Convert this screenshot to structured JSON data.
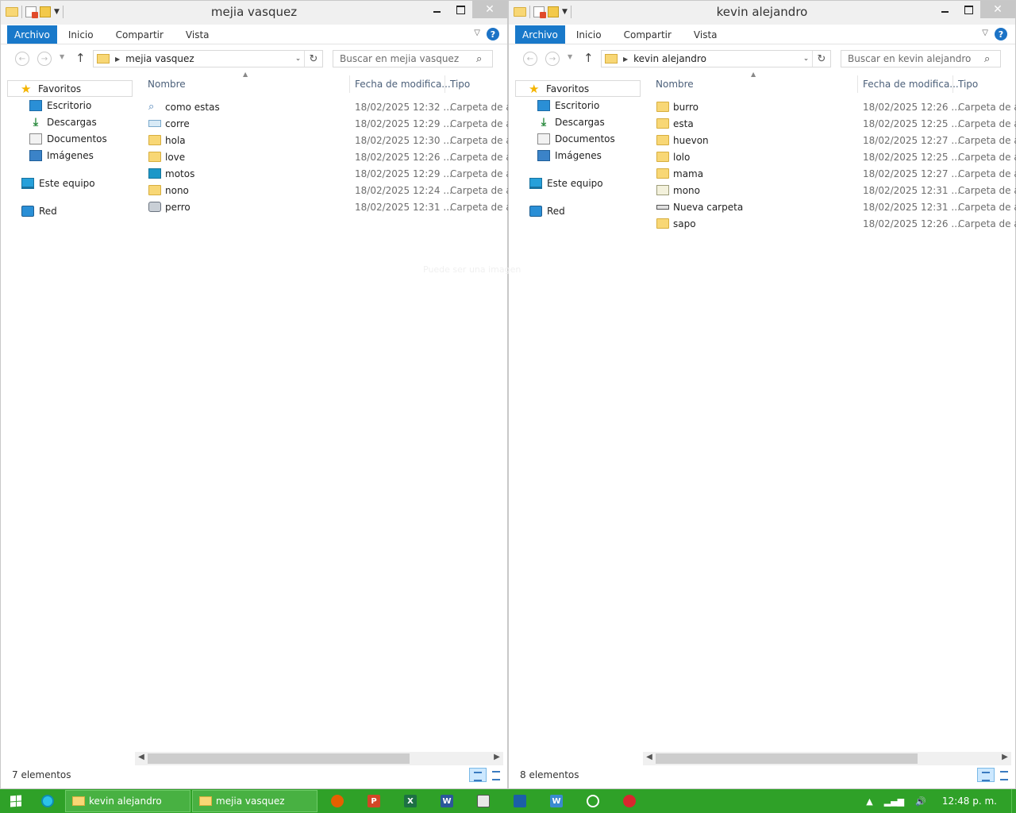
{
  "windows": [
    {
      "title": "mejia vasquez",
      "ribbon": {
        "file": "Archivo",
        "tabs": [
          "Inicio",
          "Compartir",
          "Vista"
        ]
      },
      "address": "mejia vasquez",
      "search_placeholder": "Buscar en mejia vasquez",
      "nav": {
        "favorites": "Favoritos",
        "items": [
          "Escritorio",
          "Descargas",
          "Documentos",
          "Imágenes"
        ],
        "pc": "Este equipo",
        "network": "Red"
      },
      "columns": {
        "name": "Nombre",
        "date": "Fecha de modifica...",
        "type": "Tipo"
      },
      "files": [
        {
          "name": "como estas",
          "date": "18/02/2025 12:32 ...",
          "type": "Carpeta de a",
          "icon": "search-folder-icon"
        },
        {
          "name": "corre",
          "date": "18/02/2025 12:29 ...",
          "type": "Carpeta de a",
          "icon": "drive-folder-icon"
        },
        {
          "name": "hola",
          "date": "18/02/2025 12:30 ...",
          "type": "Carpeta de a",
          "icon": "folder-icon"
        },
        {
          "name": "love",
          "date": "18/02/2025 12:26 ...",
          "type": "Carpeta de a",
          "icon": "folder-icon"
        },
        {
          "name": "motos",
          "date": "18/02/2025 12:29 ...",
          "type": "Carpeta de a",
          "icon": "monitor-folder-icon"
        },
        {
          "name": "nono",
          "date": "18/02/2025 12:24 ...",
          "type": "Carpeta de a",
          "icon": "folder-icon"
        },
        {
          "name": "perro",
          "date": "18/02/2025 12:31 ...",
          "type": "Carpeta de a",
          "icon": "disc-folder-icon"
        }
      ],
      "status": "7 elementos"
    },
    {
      "title": "kevin alejandro",
      "ribbon": {
        "file": "Archivo",
        "tabs": [
          "Inicio",
          "Compartir",
          "Vista"
        ]
      },
      "address": "kevin alejandro",
      "search_placeholder": "Buscar en kevin alejandro",
      "nav": {
        "favorites": "Favoritos",
        "items": [
          "Escritorio",
          "Descargas",
          "Documentos",
          "Imágenes"
        ],
        "pc": "Este equipo",
        "network": "Red"
      },
      "columns": {
        "name": "Nombre",
        "date": "Fecha de modifica...",
        "type": "Tipo"
      },
      "files": [
        {
          "name": "burro",
          "date": "18/02/2025 12:26 ...",
          "type": "Carpeta de a",
          "icon": "folder-icon"
        },
        {
          "name": "esta",
          "date": "18/02/2025 12:25 ...",
          "type": "Carpeta de a",
          "icon": "folder-icon"
        },
        {
          "name": "huevon",
          "date": "18/02/2025 12:27 ...",
          "type": "Carpeta de a",
          "icon": "folder-icon"
        },
        {
          "name": "lolo",
          "date": "18/02/2025 12:25 ...",
          "type": "Carpeta de a",
          "icon": "folder-icon"
        },
        {
          "name": "mama",
          "date": "18/02/2025 12:27 ...",
          "type": "Carpeta de a",
          "icon": "folder-icon"
        },
        {
          "name": "mono",
          "date": "18/02/2025 12:31 ...",
          "type": "Carpeta de a",
          "icon": "document-folder-icon"
        },
        {
          "name": "Nueva carpeta",
          "date": "18/02/2025 12:31 ...",
          "type": "Carpeta de a",
          "icon": "drive-icon"
        },
        {
          "name": "sapo",
          "date": "18/02/2025 12:26 ...",
          "type": "Carpeta de a",
          "icon": "folder-icon"
        }
      ],
      "status": "8 elementos"
    }
  ],
  "watermark": "Puede ser una imagen",
  "taskbar": {
    "tasks": [
      "kevin alejandro",
      "mejia vasquez"
    ],
    "apps": [
      "firefox-icon",
      "powerpoint-icon",
      "excel-icon",
      "word-icon",
      "chess-icon",
      "calendar-icon",
      "writer-icon",
      "settings-icon",
      "app-icon"
    ],
    "clock": "12:48 p. m."
  },
  "colors": {
    "taskbar": "#2fa128",
    "ribbon_file_tab": "#1979ca",
    "folder": "#f8d775"
  }
}
